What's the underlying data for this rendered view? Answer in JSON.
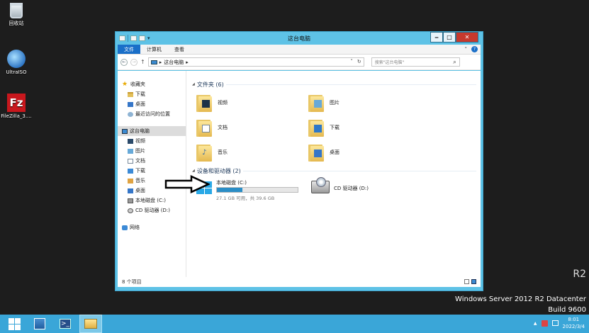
{
  "desktop": {
    "icons": [
      {
        "label": "回收站",
        "icon": "recycle-bin-icon"
      },
      {
        "label": "UltraISO",
        "icon": "ultraiso-icon"
      },
      {
        "label": "FileZilla_3....",
        "icon": "filezilla-icon"
      }
    ],
    "watermark": {
      "fragment": "R2",
      "line1": "Windows Server 2012 R2 Datacenter",
      "line2": "Build 9600"
    }
  },
  "window": {
    "title": "这台电脑",
    "controls": {
      "minimize": "‒",
      "maximize": "□",
      "close": "✕"
    },
    "ribbon": {
      "tabs": [
        "文件",
        "计算机",
        "查看"
      ],
      "collapse": "˅",
      "help": "?"
    },
    "address": {
      "back": "←",
      "forward": "→",
      "up": "↑",
      "sep": "▸",
      "path": "这台电脑",
      "end_sep": "▸",
      "dropdown": "˅",
      "refresh": "↻"
    },
    "search": {
      "placeholder": "搜索\"这台电脑\"",
      "icon": "⌕"
    },
    "nav": {
      "favorites_label": "收藏夹",
      "favorites": [
        "下载",
        "桌面",
        "最近访问的位置"
      ],
      "thispc_label": "这台电脑",
      "thispc_items": [
        "视频",
        "图片",
        "文档",
        "下载",
        "音乐",
        "桌面",
        "本地磁盘 (C:)",
        "CD 驱动器 (D:)"
      ],
      "network_label": "网络"
    },
    "folders_section": "文件夹 (6)",
    "folders": [
      {
        "name": "视频",
        "icon": "video-folder-icon"
      },
      {
        "name": "图片",
        "icon": "pictures-folder-icon"
      },
      {
        "name": "文档",
        "icon": "documents-folder-icon"
      },
      {
        "name": "下载",
        "icon": "downloads-folder-icon"
      },
      {
        "name": "音乐",
        "icon": "music-folder-icon"
      },
      {
        "name": "桌面",
        "icon": "desktop-folder-icon"
      }
    ],
    "devices_section": "设备和驱动器 (2)",
    "drive_c": {
      "name": "本地磁盘 (C:)",
      "free": "27.1 GB 可用，共 39.6 GB",
      "used_fraction": 0.316
    },
    "drive_d": {
      "name": "CD 驱动器 (D:)"
    },
    "status": "8 个项目"
  },
  "taskbar": {
    "clock_time": "8:01",
    "clock_date": "2022/3/4",
    "tray_up": "▲",
    "accent": "#3aa6d8"
  }
}
